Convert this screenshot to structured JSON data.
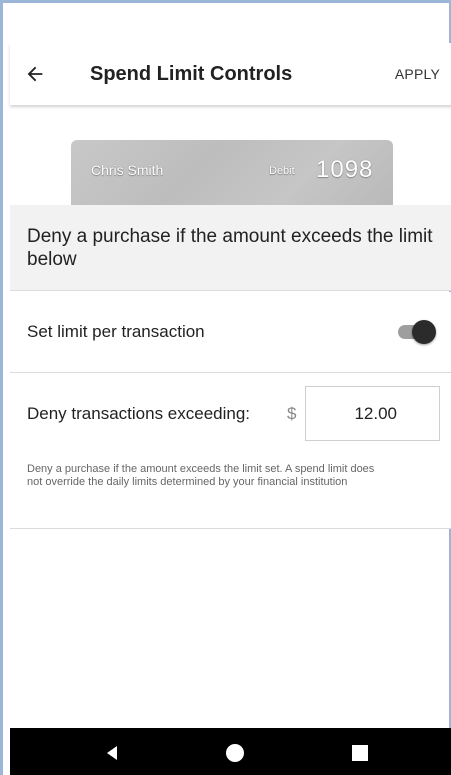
{
  "header": {
    "title": "Spend Limit Controls",
    "apply_label": "APPLY",
    "back_icon": "arrow-left-icon"
  },
  "card": {
    "holder_name": "Chris Smith",
    "type": "Debit",
    "last_four": "1098"
  },
  "banner": {
    "text": "Deny a purchase if the amount exceeds the limit below"
  },
  "limit_toggle": {
    "label": "Set limit per transaction",
    "enabled": true
  },
  "amount": {
    "label": "Deny transactions exceeding:",
    "currency_symbol": "$",
    "value": "12.00",
    "help_text": "Deny a purchase if the amount exceeds the limit set. A spend limit does not override the daily limits determined by your financial institution"
  },
  "navbar": {
    "back_icon": "triangle-back-icon",
    "home_icon": "circle-home-icon",
    "recents_icon": "square-recents-icon"
  },
  "colors": {
    "navbar": "#000000",
    "banner_bg": "#f2f2f2",
    "toggle_thumb": "#2b2b2b",
    "toggle_track": "#9e9e9e"
  }
}
